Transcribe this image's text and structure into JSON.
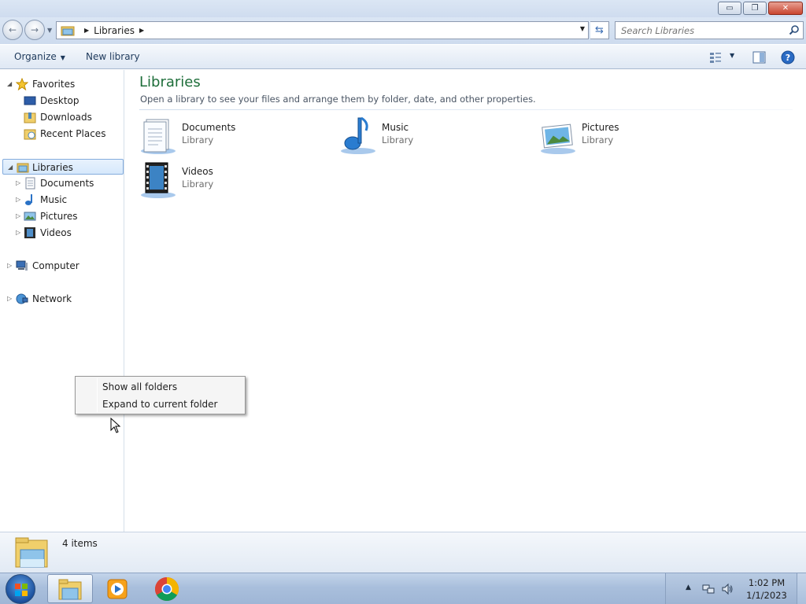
{
  "window": {
    "minimize_glyph": "▭",
    "maximize_glyph": "❐",
    "close_glyph": "✕"
  },
  "navbar": {
    "back_glyph": "←",
    "forward_glyph": "→",
    "address": {
      "crumbs": [
        "Libraries"
      ]
    },
    "search_placeholder": "Search Libraries"
  },
  "toolbar": {
    "organize_label": "Organize",
    "new_library_label": "New library"
  },
  "nav_pane": {
    "favorites": {
      "label": "Favorites",
      "items": [
        {
          "label": "Desktop",
          "icon": "desktop-icon"
        },
        {
          "label": "Downloads",
          "icon": "downloads-folder-icon"
        },
        {
          "label": "Recent Places",
          "icon": "recent-places-icon"
        }
      ]
    },
    "libraries": {
      "label": "Libraries",
      "items": [
        {
          "label": "Documents",
          "icon": "documents-icon"
        },
        {
          "label": "Music",
          "icon": "music-icon"
        },
        {
          "label": "Pictures",
          "icon": "pictures-icon"
        },
        {
          "label": "Videos",
          "icon": "videos-icon"
        }
      ]
    },
    "computer_label": "Computer",
    "network_label": "Network"
  },
  "content": {
    "title": "Libraries",
    "subtitle": "Open a library to see your files and arrange them by folder, date, and other properties.",
    "libraries": [
      {
        "name": "Documents",
        "type": "Library",
        "icon": "documents-library-icon"
      },
      {
        "name": "Music",
        "type": "Library",
        "icon": "music-library-icon"
      },
      {
        "name": "Pictures",
        "type": "Library",
        "icon": "pictures-library-icon"
      },
      {
        "name": "Videos",
        "type": "Library",
        "icon": "videos-library-icon"
      }
    ]
  },
  "context_menu": {
    "items": [
      "Show all folders",
      "Expand to current folder"
    ]
  },
  "details_pane": {
    "item_count": "4 items"
  },
  "taskbar": {
    "clock_time": "1:02 PM",
    "clock_date": "1/1/2023"
  },
  "colors": {
    "title_green": "#1e6e3a",
    "selection_border": "#84acdd",
    "toolbar_text": "#1e395b"
  }
}
